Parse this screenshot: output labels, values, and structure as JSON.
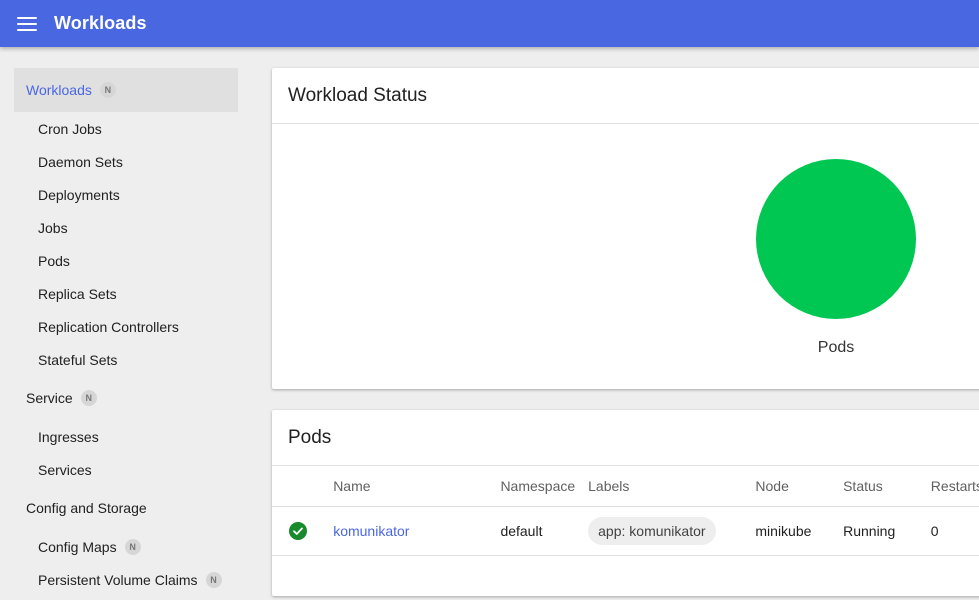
{
  "topbar": {
    "title": "Workloads",
    "menu_icon": "menu-icon",
    "color": "#4a67e2"
  },
  "sidebar": {
    "workloads": {
      "label": "Workloads",
      "badge": "N",
      "items": [
        "Cron Jobs",
        "Daemon Sets",
        "Deployments",
        "Jobs",
        "Pods",
        "Replica Sets",
        "Replication Controllers",
        "Stateful Sets"
      ]
    },
    "service": {
      "label": "Service",
      "badge": "N",
      "items": [
        "Ingresses",
        "Services"
      ]
    },
    "config": {
      "label": "Config and Storage",
      "items": [
        {
          "label": "Config Maps",
          "badge": "N"
        },
        {
          "label": "Persistent Volume Claims",
          "badge": "N"
        }
      ]
    }
  },
  "workload_status": {
    "title": "Workload Status",
    "chart_label": "Pods",
    "running_fraction": 1.0,
    "running_color": "#00c752"
  },
  "pods": {
    "title": "Pods",
    "columns": [
      "Name",
      "Namespace",
      "Labels",
      "Node",
      "Status",
      "Restarts"
    ],
    "rows": [
      {
        "status_icon": "check-circle-icon",
        "name": "komunikator",
        "namespace": "default",
        "label": "app: komunikator",
        "node": "minikube",
        "status": "Running",
        "restarts": "0"
      }
    ]
  }
}
